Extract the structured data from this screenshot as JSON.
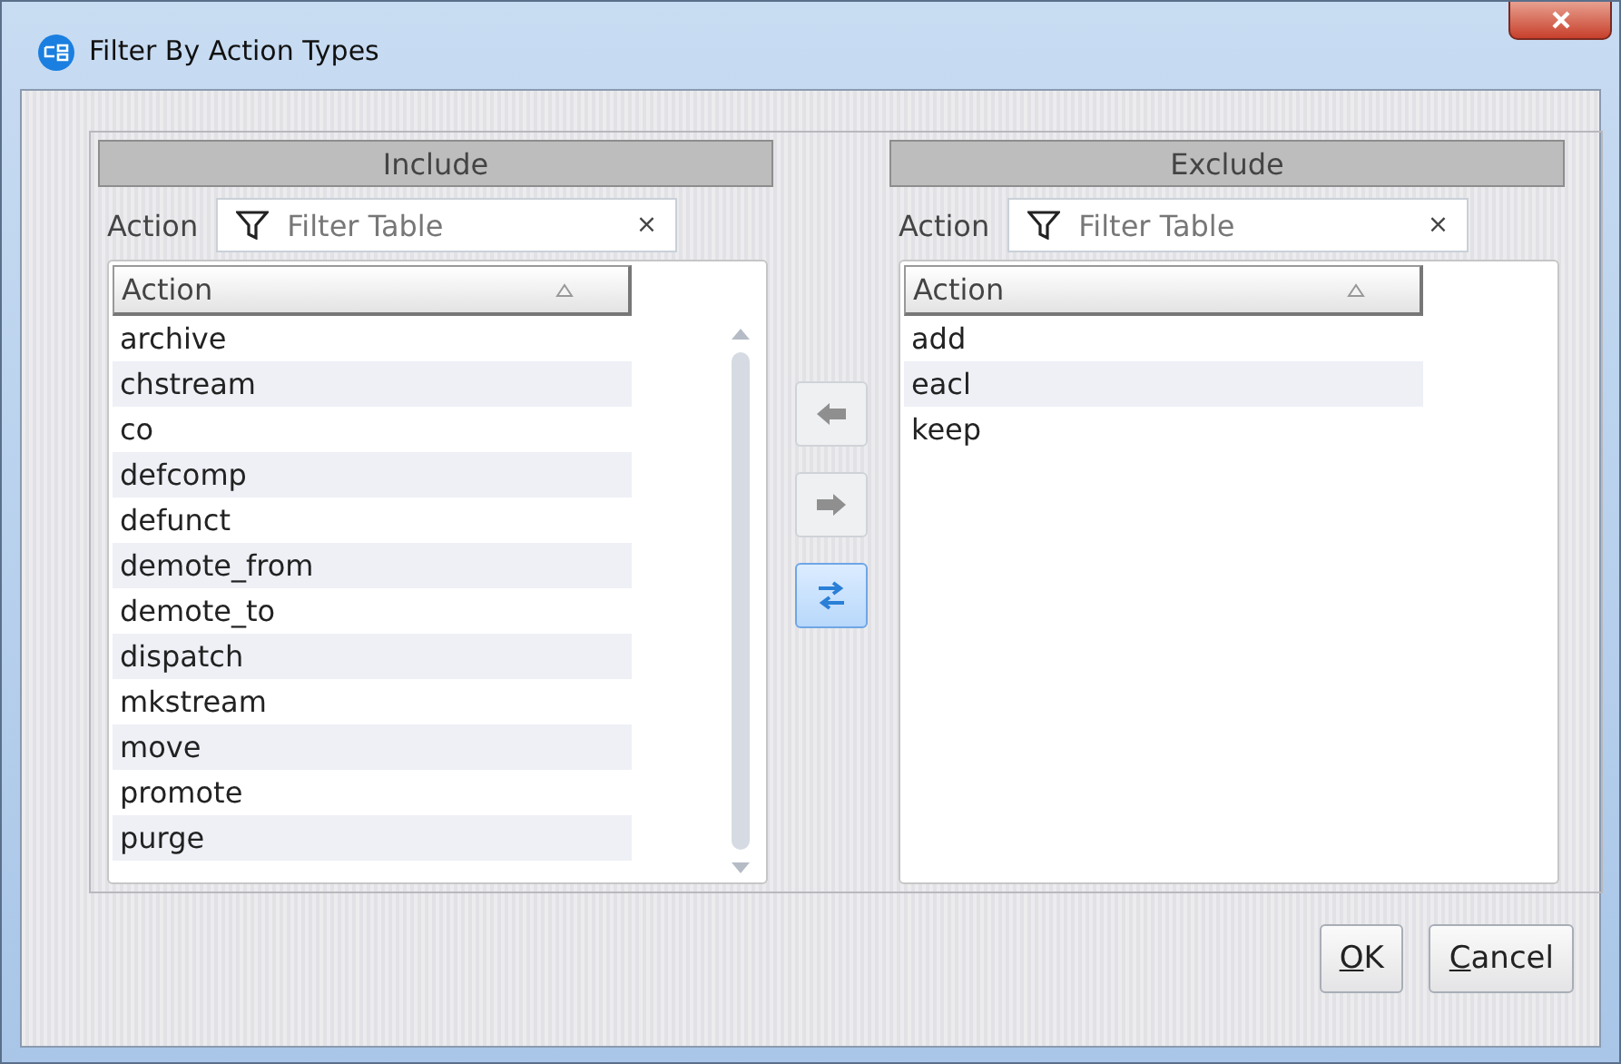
{
  "window": {
    "title": "Filter By Action Types"
  },
  "panels": [
    {
      "heading": "Include",
      "filter_label": "Action",
      "filter_placeholder": "Filter Table",
      "clear": "×",
      "column": "Action",
      "scrollbar": true,
      "rows": [
        "archive",
        "chstream",
        "co",
        "defcomp",
        "defunct",
        "demote_from",
        "demote_to",
        "dispatch",
        "mkstream",
        "move",
        "promote",
        "purge"
      ]
    },
    {
      "heading": "Exclude",
      "filter_label": "Action",
      "filter_placeholder": "Filter Table",
      "clear": "×",
      "column": "Action",
      "scrollbar": false,
      "rows": [
        "add",
        "eacl",
        "keep"
      ]
    }
  ],
  "move_buttons": [
    {
      "kind": "left",
      "disabled": true
    },
    {
      "kind": "right",
      "disabled": true
    },
    {
      "kind": "swap",
      "disabled": false
    }
  ],
  "buttons": [
    {
      "label": "OK",
      "mnemonic": true
    },
    {
      "label": "Cancel",
      "mnemonic": true
    }
  ]
}
